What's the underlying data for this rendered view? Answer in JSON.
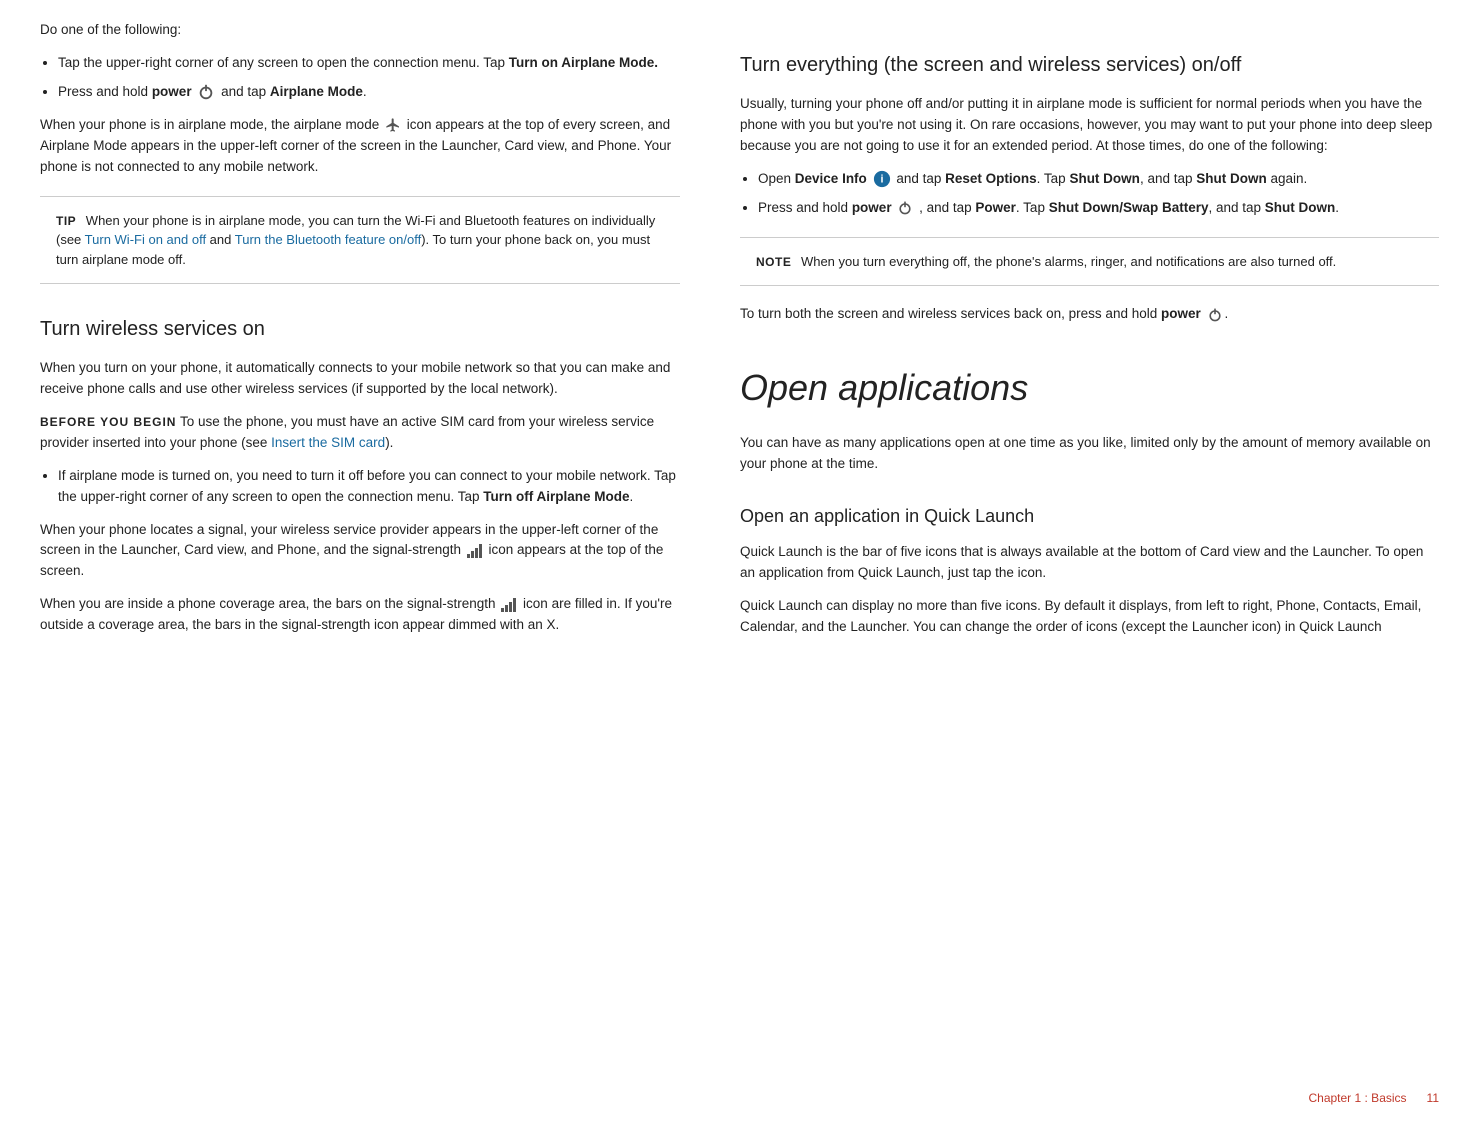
{
  "page": {
    "footer": {
      "chapter_label": "Chapter 1  :  Basics",
      "page_number": "11"
    }
  },
  "left_col": {
    "intro": {
      "text": "Do one of the following:"
    },
    "bullets_1": [
      {
        "text_before": "Tap the upper-right corner of any screen to open the connection menu. Tap ",
        "bold": "Turn on Airplane Mode.",
        "text_after": ""
      },
      {
        "text_before": "Press and hold ",
        "bold_1": "power",
        "icon": "power",
        "text_mid": " and tap ",
        "bold_2": "Airplane Mode",
        "text_after": "."
      }
    ],
    "airplane_mode_desc": "When your phone is in airplane mode, the airplane mode",
    "airplane_mode_desc2": " icon appears at the top of every screen, and Airplane Mode appears in the upper-left corner of the screen in the Launcher, Card view, and Phone. Your phone is not connected to any mobile network.",
    "tip_box": {
      "label": "TIP",
      "text": " When your phone is in airplane mode, you can turn the Wi-Fi and Bluetooth features on individually (see ",
      "link1": "Turn Wi-Fi on and off",
      "text2": " and ",
      "link2": "Turn the Bluetooth feature on/off",
      "text3": "). To turn your phone back on, you must turn airplane mode off."
    },
    "section1": {
      "heading": "Turn wireless services on",
      "para1": "When you turn on your phone, it automatically connects to your mobile network so that you can make and receive phone calls and use other wireless services (if supported by the local network).",
      "before_you_begin_label": "BEFORE YOU BEGIN",
      "before_you_begin_text": "  To use the phone, you must have an active SIM card from your wireless service provider inserted into your phone (see ",
      "link": "Insert the SIM card",
      "text_after": ")."
    },
    "bullets_2": [
      {
        "text_before": "If airplane mode is turned on, you need to turn it off before you can connect to your mobile network. Tap the upper-right corner of any screen to open the connection menu. Tap ",
        "bold": "Turn off Airplane Mode",
        "text_after": "."
      }
    ],
    "para_signal_1": "When your phone locates a signal, your wireless service provider appears in the upper-left corner of the screen in the Launcher, Card view, and Phone, and the signal-strength",
    "para_signal_1b": " icon appears at the top of the screen.",
    "para_signal_2": "When you are inside a phone coverage area, the bars on the signal-strength",
    "para_signal_2b": " icon are filled in. If you're outside a coverage area, the bars in the signal-strength icon appear dimmed with an X."
  },
  "right_col": {
    "section_turn_off": {
      "heading": "Turn everything (the screen and wireless services) on/off",
      "para1": "Usually, turning your phone off and/or putting it in airplane mode is sufficient for normal periods when you have the phone with you but you're not using it. On rare occasions, however, you may want to put your phone into deep sleep because you are not going to use it for an extended period. At those times, do one of the following:",
      "bullets": [
        {
          "text_before": "Open ",
          "bold_1": "Device Info",
          "icon": "device",
          "text_mid": " and tap ",
          "bold_2": "Reset Options",
          "text_mid2": ". Tap ",
          "bold_3": "Shut Down",
          "text_mid3": ", and tap ",
          "bold_4": "Shut Down",
          "text_after": " again."
        },
        {
          "text_before": "Press and hold ",
          "bold_1": "power",
          "icon": "power",
          "text_mid": ", and tap ",
          "bold_2": "Power",
          "text_mid2": ". Tap ",
          "bold_3": "Shut Down/Swap Battery",
          "text_mid3": ", and tap ",
          "bold_4": "Shut Down",
          "text_after": "."
        }
      ],
      "note_box": {
        "label": "NOTE",
        "text": " When you turn everything off, the phone's alarms, ringer, and notifications are also turned off."
      },
      "turn_back_on": "To turn both the screen and wireless services back on, press and hold ",
      "turn_back_on_bold": "power",
      "turn_back_on_after": "."
    },
    "section_open_apps": {
      "heading": "Open applications",
      "para1": "You can have as many applications open at one time as you like, limited only by the amount of memory available on your phone at the time.",
      "sub_heading": "Open an application in Quick Launch",
      "para2": "Quick Launch is the bar of five icons that is always available at the bottom of Card view and the Launcher. To open an application from Quick Launch, just tap the icon.",
      "para3": "Quick Launch can display no more than five icons. By default it displays, from left to right, Phone, Contacts, Email, Calendar, and the Launcher. You can change the order of icons (except the Launcher icon) in Quick Launch"
    }
  }
}
